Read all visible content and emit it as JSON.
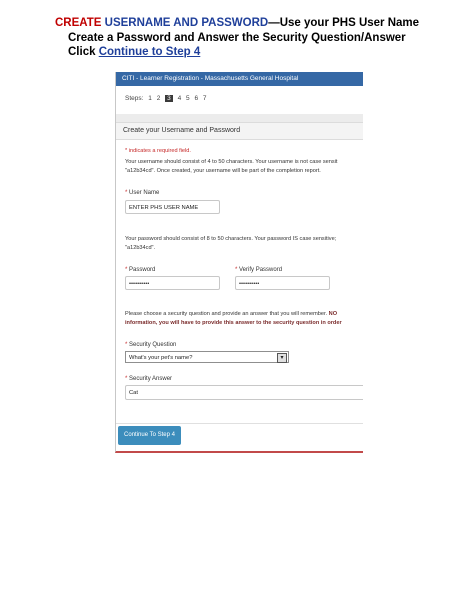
{
  "instructions": {
    "line1_create": "CREATE",
    "line1_username_password": "USERNAME AND PASSWORD",
    "line1_rest": "—Use your PHS User Name",
    "line2": "Create a Password and Answer the Security Question/Answer",
    "line3_click": "Click",
    "line3_link": "Continue to Step 4"
  },
  "window": {
    "title": "CITI - Learner Registration - Massachusetts General Hospital"
  },
  "steps": {
    "label": "Steps:",
    "items": [
      "1",
      "2",
      "3",
      "4",
      "5",
      "6",
      "7"
    ],
    "current": "3"
  },
  "section_title": "Create your Username and Password",
  "required_note": "* indicates a required field.",
  "username_help": {
    "line1": "Your username should consist of 4 to 50 characters. Your username is not case sensit",
    "line2": "\"a12b34cd\". Once created, your username will be part of the completion report."
  },
  "username": {
    "label": "User Name",
    "value": "ENTER PHS USER NAME"
  },
  "password_help": {
    "line1": "Your password should consist of 8 to 50 characters. Your password IS case sensitive;",
    "line2": "\"a12b34cd\"."
  },
  "password": {
    "label": "Password",
    "value": "••••••••••"
  },
  "verify_password": {
    "label": "Verify Password",
    "value": "••••••••••"
  },
  "security_help": {
    "line1_normal": "Please choose a security question and provide an answer that you will remember.",
    "line1_bold": "NO",
    "line2": "information, you will have to provide this answer to the security question in order"
  },
  "security_question": {
    "label": "Security Question",
    "selected": "What's your pet's name?"
  },
  "security_answer": {
    "label": "Security Answer",
    "value": "Cat"
  },
  "continue_button": "Continue To Step 4"
}
